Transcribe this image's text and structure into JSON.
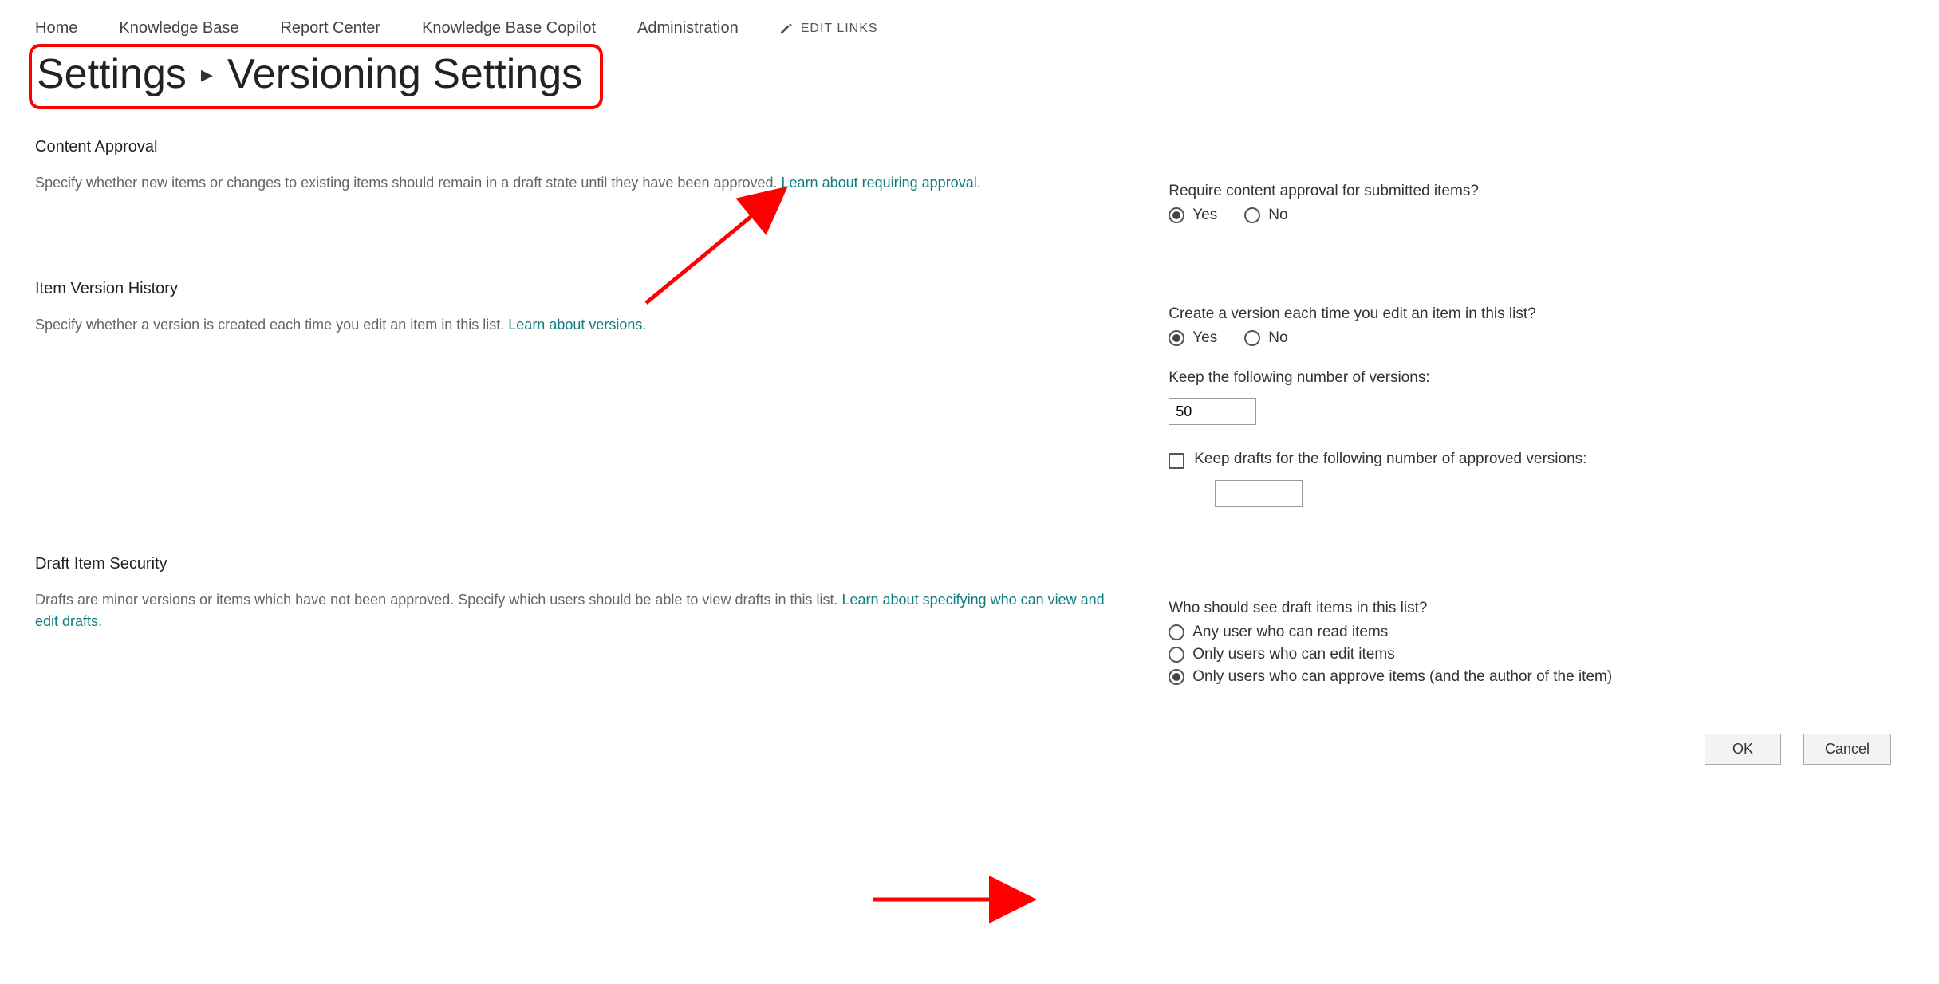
{
  "nav": {
    "items": [
      "Home",
      "Knowledge Base",
      "Report Center",
      "Knowledge Base Copilot",
      "Administration"
    ],
    "edit_links": "EDIT LINKS"
  },
  "breadcrumb": {
    "parent": "Settings",
    "current": "Versioning Settings"
  },
  "sections": {
    "content_approval": {
      "title": "Content Approval",
      "desc_prefix": "Specify whether new items or changes to existing items should remain in a draft state until they have been approved.  ",
      "link": "Learn about requiring approval.",
      "q1": "Require content approval for submitted items?",
      "yes": "Yes",
      "no": "No",
      "selected": "yes"
    },
    "version_history": {
      "title": "Item Version History",
      "desc_prefix": "Specify whether a version is created each time you edit an item in this list.  ",
      "link": "Learn about versions.",
      "q1": "Create a version each time you edit an item in this list?",
      "yes": "Yes",
      "no": "No",
      "selected": "yes",
      "keep_label": "Keep the following number of versions:",
      "keep_value": "50",
      "drafts_checkbox_label": "Keep drafts for the following number of approved versions:",
      "drafts_value": ""
    },
    "draft_security": {
      "title": "Draft Item Security",
      "desc_prefix": "Drafts are minor versions or items which have not been approved. Specify which users should be able to view drafts in this list.  ",
      "link": "Learn about specifying who can view and edit drafts.",
      "q1": "Who should see draft items in this list?",
      "opt1": "Any user who can read items",
      "opt2": "Only users who can edit items",
      "opt3": "Only users who can approve items (and the author of the item)",
      "selected": "opt3"
    }
  },
  "buttons": {
    "ok": "OK",
    "cancel": "Cancel"
  }
}
